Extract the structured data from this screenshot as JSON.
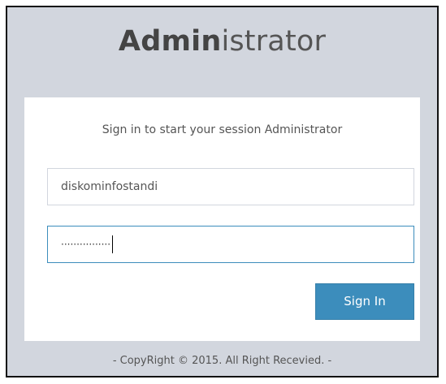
{
  "logo": {
    "bold": "Admin",
    "light": "istrator"
  },
  "login": {
    "message": "Sign in to start your session Administrator",
    "username_value": "diskominfostandi",
    "password_masked": "················",
    "signin_label": "Sign In"
  },
  "footer": {
    "text": "- CopyRight © 2015. All Right Recevied. -"
  },
  "colors": {
    "background": "#d2d6de",
    "primary": "#3c8dbc"
  }
}
